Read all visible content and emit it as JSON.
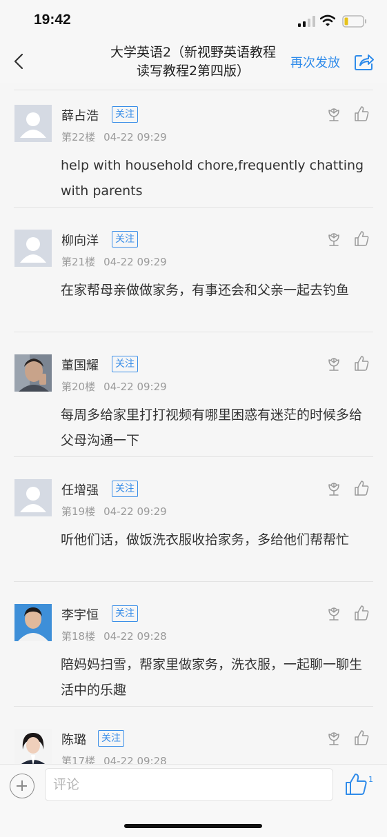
{
  "status_bar": {
    "time": "19:42"
  },
  "nav": {
    "title_line1": "大学英语2（新视野英语教程",
    "title_line2": "读写教程2第四版）",
    "resend_label": "再次发放"
  },
  "comments": [
    {
      "name": "薛占浩",
      "follow": "关注",
      "floor": "第22楼",
      "time": "04-22 09:29",
      "text": "help with household chore,frequently chatting with parents",
      "avatar": "default-avatar"
    },
    {
      "name": "柳向洋",
      "follow": "关注",
      "floor": "第21楼",
      "time": "04-22 09:29",
      "text": "在家帮母亲做做家务，有事还会和父亲一起去钓鱼",
      "avatar": "default-avatar"
    },
    {
      "name": "董国耀",
      "follow": "关注",
      "floor": "第20楼",
      "time": "04-22 09:29",
      "text": "每周多给家里打打视频有哪里困惑有迷茫的时候多给父母沟通一下",
      "avatar": "photo-avatar"
    },
    {
      "name": "任增强",
      "follow": "关注",
      "floor": "第19楼",
      "time": "04-22 09:29",
      "text": "听他们话，做饭洗衣服收拾家务，多给他们帮帮忙",
      "avatar": "default-avatar"
    },
    {
      "name": "李宇恒",
      "follow": "关注",
      "floor": "第18楼",
      "time": "04-22 09:28",
      "text": "陪妈妈扫雪，帮家里做家务，洗衣服，一起聊一聊生活中的乐趣",
      "avatar": "photo-avatar"
    },
    {
      "name": "陈璐",
      "follow": "关注",
      "floor": "第17楼",
      "time": "04-22 09:28",
      "text": "",
      "avatar": "photo-avatar"
    }
  ],
  "bottom_bar": {
    "comment_placeholder": "评论",
    "like_count": "1"
  },
  "colors": {
    "accent": "#2f8bea",
    "meta_text": "#9a9a9a",
    "background": "#f6f6f6"
  }
}
